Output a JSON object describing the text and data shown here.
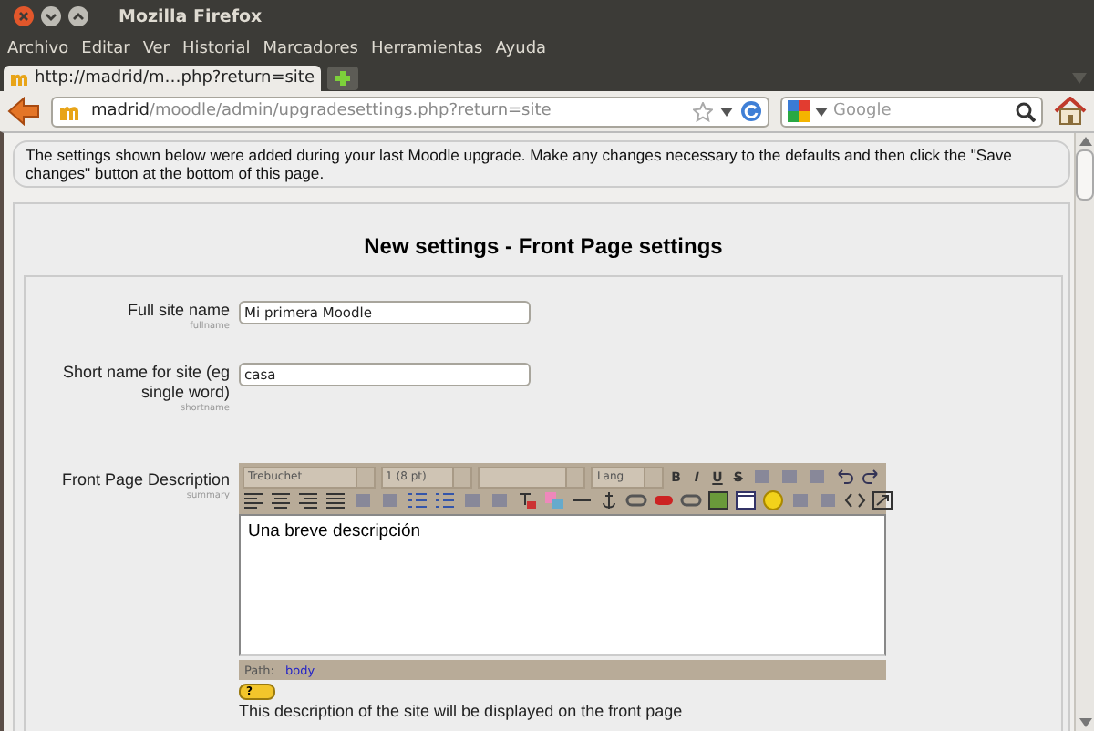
{
  "window": {
    "title": "Mozilla Firefox"
  },
  "menu": [
    {
      "label": "Archivo"
    },
    {
      "label": "Editar"
    },
    {
      "label": "Ver"
    },
    {
      "label": "Historial"
    },
    {
      "label": "Marcadores"
    },
    {
      "label": "Herramientas"
    },
    {
      "label": "Ayuda"
    }
  ],
  "tabs": [
    {
      "label": "http://madrid/m…php?return=site",
      "selected": true
    }
  ],
  "address": {
    "host": "madrid",
    "path": "/moodle/admin/upgradesettings.php?return=site"
  },
  "search": {
    "placeholder": "Google"
  },
  "notice": "The settings shown below were added during your last Moodle upgrade. Make any changes necessary to the defaults and then click the \"Save changes\" button at the bottom of this page.",
  "heading": "New settings - Front Page settings",
  "settings": [
    {
      "kind": "text",
      "label": "Full site name",
      "name": "fullname",
      "value": "Mi primera Moodle"
    },
    {
      "kind": "text",
      "label": "Short name for site (eg single word)",
      "name": "shortname",
      "value": "casa"
    },
    {
      "kind": "editor",
      "label": "Front Page Description",
      "name": "summary",
      "value": "Una breve descripción",
      "selects": [
        {
          "kind": "select",
          "label": "Trebuchet"
        },
        {
          "kind": "select",
          "label": "1 (8 pt)"
        },
        {
          "kind": "select"
        },
        {
          "kind": "select",
          "label": "Lang"
        }
      ],
      "format": [
        "B",
        "I",
        "U",
        "S"
      ],
      "path_label": "Path:",
      "path": "body",
      "help": "?",
      "description": "This description of the site will be displayed on the front page"
    }
  ]
}
